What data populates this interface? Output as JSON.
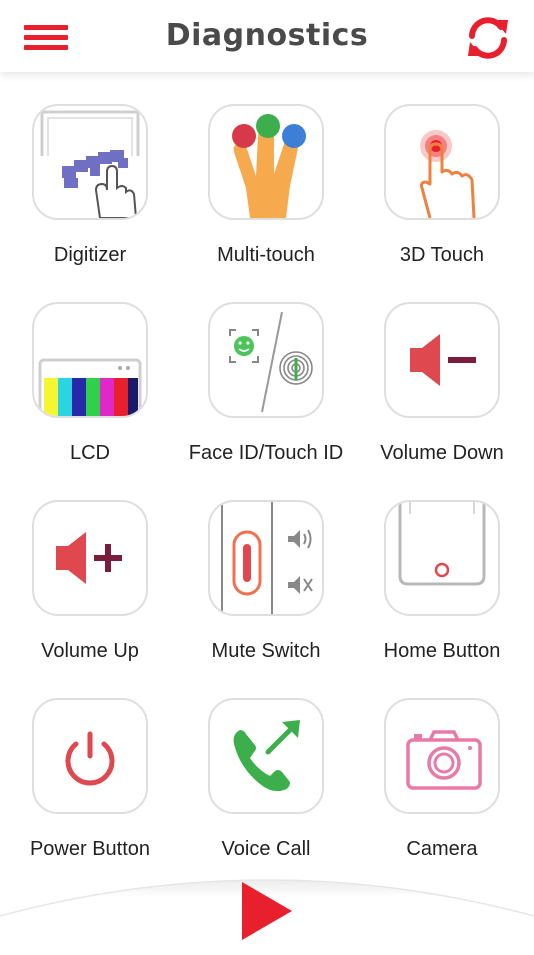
{
  "header": {
    "title": "Diagnostics",
    "menu_icon": "hamburger-menu-icon",
    "refresh_icon": "refresh-icon"
  },
  "tests": [
    {
      "label": "Digitizer",
      "icon": "digitizer-icon"
    },
    {
      "label": "Multi-touch",
      "icon": "multi-touch-icon"
    },
    {
      "label": "3D Touch",
      "icon": "3d-touch-icon"
    },
    {
      "label": "LCD",
      "icon": "lcd-icon"
    },
    {
      "label": "Face ID/Touch ID",
      "icon": "face-id-touch-id-icon"
    },
    {
      "label": "Volume Down",
      "icon": "volume-down-icon"
    },
    {
      "label": "Volume Up",
      "icon": "volume-up-icon"
    },
    {
      "label": "Mute Switch",
      "icon": "mute-switch-icon"
    },
    {
      "label": "Home Button",
      "icon": "home-button-icon"
    },
    {
      "label": "Power Button",
      "icon": "power-icon"
    },
    {
      "label": "Voice Call",
      "icon": "voice-call-icon"
    },
    {
      "label": "Camera",
      "icon": "camera-icon"
    }
  ],
  "footer": {
    "play_icon": "play-icon"
  },
  "colors": {
    "accent": "#e8202e",
    "title": "#4a4a4a",
    "tile_border": "#dedede"
  }
}
